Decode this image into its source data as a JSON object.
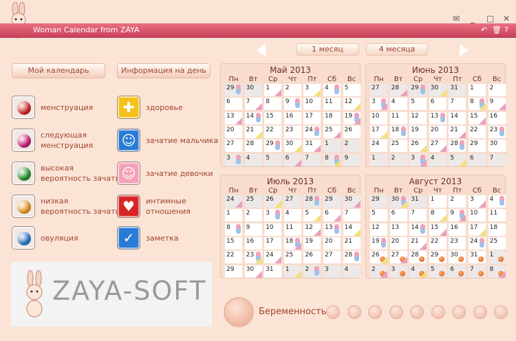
{
  "window": {
    "title": "Woman Calendar from ZAYA",
    "mail_icon": "✉",
    "min": "_",
    "max": "□",
    "close": "✕",
    "undo": "↶",
    "trash": "🗑",
    "help": "?"
  },
  "nav": {
    "one_month": "1 месяц",
    "four_months": "4 месяца"
  },
  "left": {
    "my_calendar": "Мой календарь",
    "day_info": "Информация на день"
  },
  "legend": [
    {
      "label": "менструация",
      "color": "#d92424"
    },
    {
      "label": "следующая\nменструация",
      "color": "#d61a7c"
    },
    {
      "label": "высокая\nвероятность зачати",
      "color": "#1f9a2a"
    },
    {
      "label": "низкая\nвероятность зачати",
      "color": "#f2a020"
    },
    {
      "label": "овуляция",
      "color": "#2a7bd4"
    },
    {
      "label": "здоровье",
      "icon": "health-cross-icon",
      "color": "#f4c21b"
    },
    {
      "label": "зачатие мальчика",
      "icon": "boy-icon",
      "color": "#2a7bd4"
    },
    {
      "label": "зачатие девочки",
      "icon": "girl-icon",
      "color": "#f3a2b8"
    },
    {
      "label": "интимные\nотношения",
      "icon": "heart-icon",
      "color": "#d92424"
    },
    {
      "label": "заметка",
      "icon": "check-icon",
      "color": "#2a7bd4"
    }
  ],
  "logo": "ZAYA-SOFT",
  "weekdays": [
    "Пн",
    "Вт",
    "Ср",
    "Чт",
    "Пт",
    "Сб",
    "Вс"
  ],
  "calendars": [
    {
      "title": "Май 2013",
      "days": [
        29,
        30,
        1,
        2,
        3,
        4,
        5,
        6,
        7,
        8,
        9,
        10,
        11,
        12,
        13,
        14,
        15,
        16,
        17,
        18,
        19,
        20,
        21,
        22,
        23,
        24,
        25,
        26,
        27,
        28,
        29,
        30,
        31,
        1,
        2,
        3,
        4,
        5,
        6,
        7,
        8,
        9
      ],
      "prev": 2,
      "next_from": 33
    },
    {
      "title": "Июнь 2013",
      "days": [
        27,
        28,
        29,
        30,
        31,
        1,
        2,
        3,
        4,
        5,
        6,
        7,
        8,
        9,
        10,
        11,
        12,
        13,
        14,
        15,
        16,
        17,
        18,
        19,
        20,
        21,
        22,
        23,
        24,
        25,
        26,
        27,
        28,
        29,
        30,
        1,
        2,
        3,
        4,
        5,
        6,
        7
      ],
      "prev": 5,
      "next_from": 35
    },
    {
      "title": "Июль 2013",
      "days": [
        24,
        25,
        26,
        27,
        28,
        29,
        30,
        1,
        2,
        3,
        4,
        5,
        6,
        7,
        8,
        9,
        10,
        11,
        12,
        13,
        14,
        15,
        16,
        17,
        18,
        19,
        20,
        21,
        22,
        23,
        24,
        25,
        26,
        27,
        28,
        29,
        30,
        31,
        1,
        2,
        3,
        4
      ],
      "prev": 7,
      "next_from": 38
    },
    {
      "title": "Август 2013",
      "days": [
        29,
        30,
        31,
        1,
        2,
        3,
        4,
        5,
        6,
        7,
        8,
        9,
        10,
        11,
        12,
        13,
        14,
        15,
        16,
        17,
        18,
        19,
        20,
        21,
        22,
        23,
        24,
        25,
        26,
        27,
        28,
        29,
        30,
        31,
        1,
        2,
        3,
        4,
        5,
        6,
        7,
        8
      ],
      "prev": 3,
      "next_from": 34
    }
  ],
  "pregnancy": {
    "label": "Беременность"
  }
}
